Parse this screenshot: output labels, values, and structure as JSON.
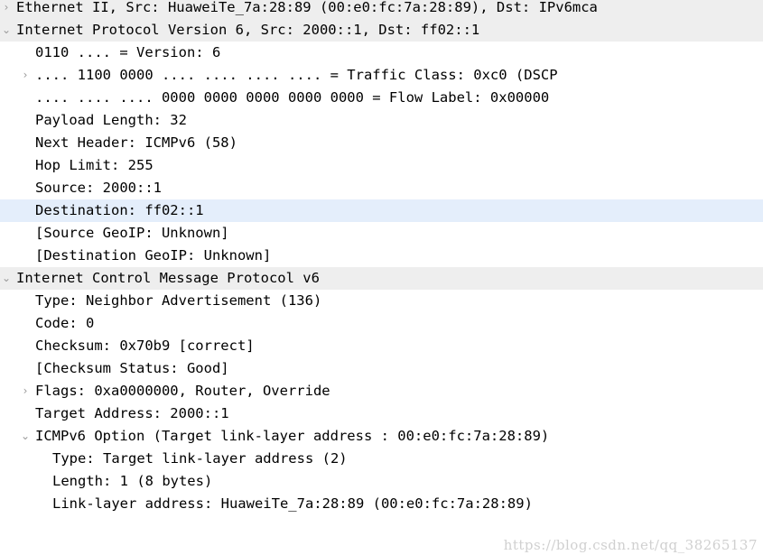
{
  "pane": {
    "name": "packet-details",
    "selection_color": "#e4eefb",
    "protocol_row_color": "#eeeeee",
    "text_color": "#000000",
    "background_color": "#ffffff"
  },
  "rows": [
    {
      "text": "Ethernet II, Src: HuaweiTe_7a:28:89 (00:e0:fc:7a:28:89), Dst: IPv6mca",
      "depth": 0,
      "twisty": "collapsed",
      "style": "proto",
      "name": "tree-row-ethernet-ii"
    },
    {
      "text": "Internet Protocol Version 6, Src: 2000::1, Dst: ff02::1",
      "depth": 0,
      "twisty": "expanded",
      "style": "proto",
      "name": "tree-row-ipv6"
    },
    {
      "text": "0110 .... = Version: 6",
      "depth": 1,
      "twisty": "none",
      "style": "plain",
      "name": "tree-row-version"
    },
    {
      "text": ".... 1100 0000 .... .... .... .... = Traffic Class: 0xc0 (DSCP",
      "depth": 1,
      "twisty": "collapsed",
      "style": "plain",
      "name": "tree-row-traffic-class"
    },
    {
      "text": ".... .... .... 0000 0000 0000 0000 0000 = Flow Label: 0x00000",
      "depth": 1,
      "twisty": "none",
      "style": "plain",
      "name": "tree-row-flow-label"
    },
    {
      "text": "Payload Length: 32",
      "depth": 1,
      "twisty": "none",
      "style": "plain",
      "name": "tree-row-payload-length"
    },
    {
      "text": "Next Header: ICMPv6 (58)",
      "depth": 1,
      "twisty": "none",
      "style": "plain",
      "name": "tree-row-next-header"
    },
    {
      "text": "Hop Limit: 255",
      "depth": 1,
      "twisty": "none",
      "style": "plain",
      "name": "tree-row-hop-limit"
    },
    {
      "text": "Source: 2000::1",
      "depth": 1,
      "twisty": "none",
      "style": "plain",
      "name": "tree-row-source-address"
    },
    {
      "text": "Destination: ff02::1",
      "depth": 1,
      "twisty": "none",
      "style": "selected",
      "name": "tree-row-destination-address"
    },
    {
      "text": "[Source GeoIP: Unknown]",
      "depth": 1,
      "twisty": "none",
      "style": "plain",
      "name": "tree-row-source-geoip"
    },
    {
      "text": "[Destination GeoIP: Unknown]",
      "depth": 1,
      "twisty": "none",
      "style": "plain",
      "name": "tree-row-destination-geoip"
    },
    {
      "text": "Internet Control Message Protocol v6",
      "depth": 0,
      "twisty": "expanded",
      "style": "proto",
      "name": "tree-row-icmpv6"
    },
    {
      "text": "Type: Neighbor Advertisement (136)",
      "depth": 1,
      "twisty": "none",
      "style": "plain",
      "name": "tree-row-icmpv6-type"
    },
    {
      "text": "Code: 0",
      "depth": 1,
      "twisty": "none",
      "style": "plain",
      "name": "tree-row-icmpv6-code"
    },
    {
      "text": "Checksum: 0x70b9 [correct]",
      "depth": 1,
      "twisty": "none",
      "style": "plain",
      "name": "tree-row-icmpv6-checksum"
    },
    {
      "text": "[Checksum Status: Good]",
      "depth": 1,
      "twisty": "none",
      "style": "plain",
      "name": "tree-row-icmpv6-checksum-status"
    },
    {
      "text": "Flags: 0xa0000000, Router, Override",
      "depth": 1,
      "twisty": "collapsed",
      "style": "plain",
      "name": "tree-row-icmpv6-flags"
    },
    {
      "text": "Target Address: 2000::1",
      "depth": 1,
      "twisty": "none",
      "style": "plain",
      "name": "tree-row-target-address"
    },
    {
      "text": "ICMPv6 Option (Target link-layer address : 00:e0:fc:7a:28:89)",
      "depth": 1,
      "twisty": "expanded",
      "style": "plain",
      "name": "tree-row-icmpv6-option"
    },
    {
      "text": "Type: Target link-layer address (2)",
      "depth": 2,
      "twisty": "none",
      "style": "plain",
      "name": "tree-row-option-type"
    },
    {
      "text": "Length: 1 (8 bytes)",
      "depth": 2,
      "twisty": "none",
      "style": "plain",
      "name": "tree-row-option-length"
    },
    {
      "text": "Link-layer address: HuaweiTe_7a:28:89 (00:e0:fc:7a:28:89)",
      "depth": 2,
      "twisty": "none",
      "style": "plain",
      "name": "tree-row-link-layer-address"
    }
  ],
  "watermark": {
    "text": "https://blog.csdn.net/qq_38265137"
  }
}
